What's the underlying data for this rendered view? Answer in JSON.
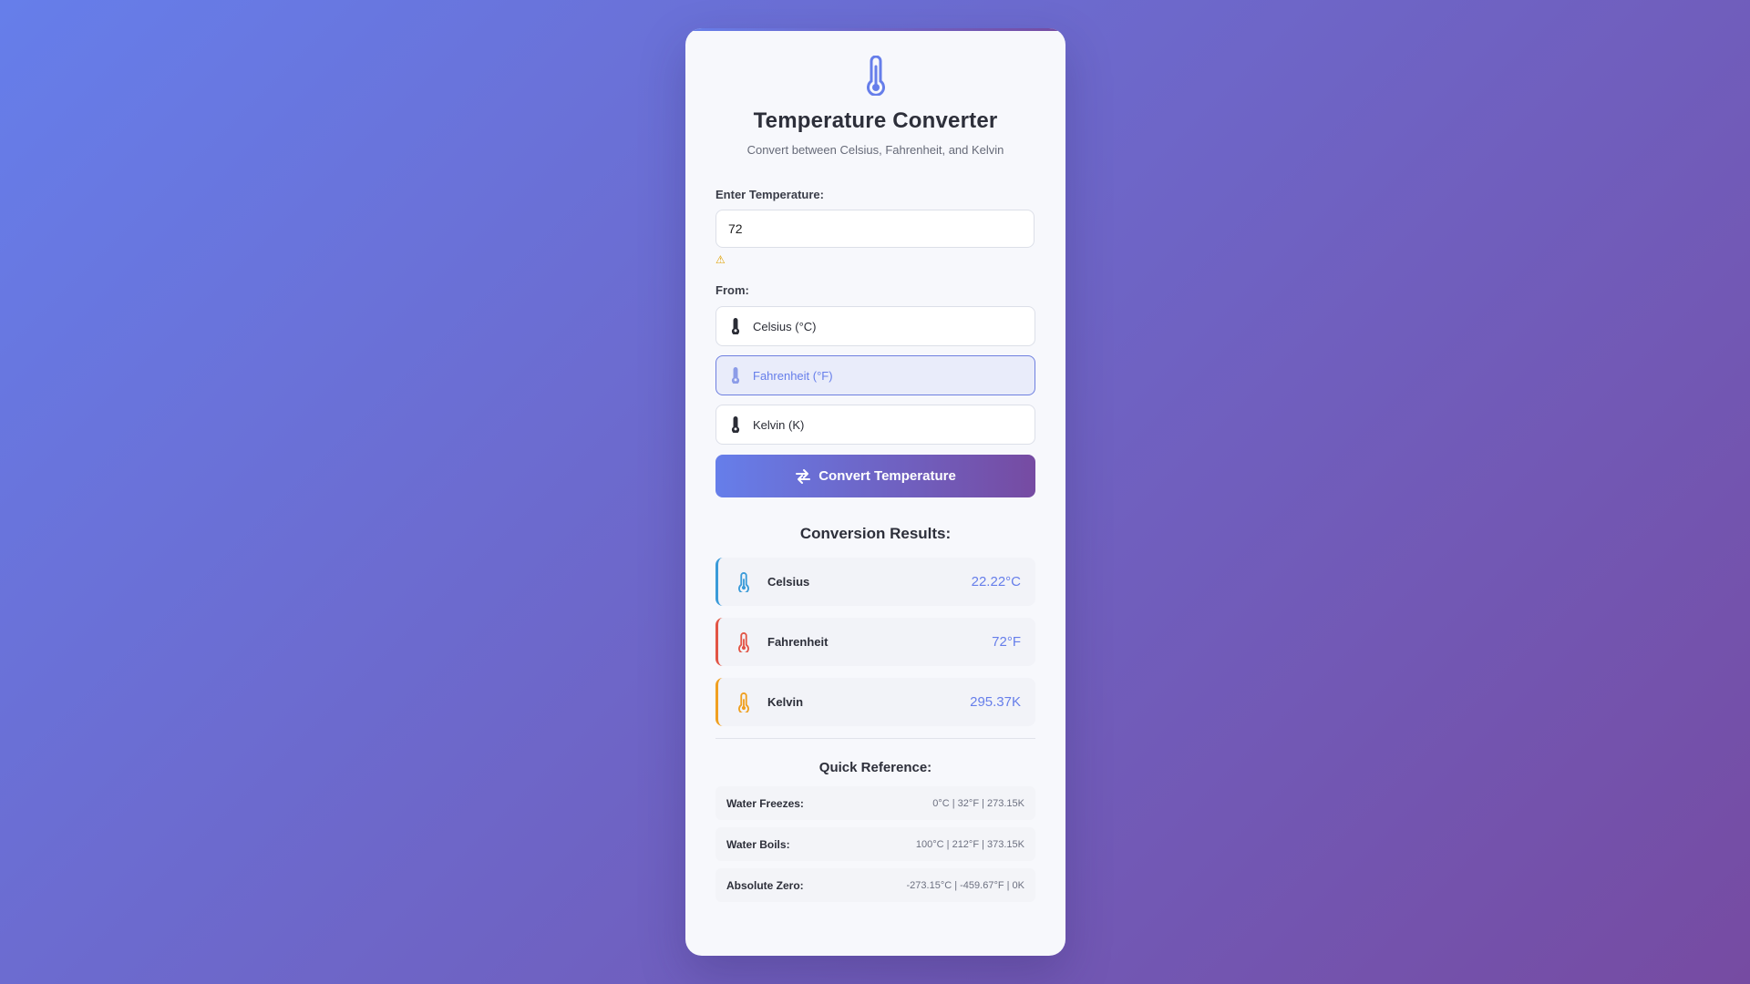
{
  "header": {
    "title": "Temperature Converter",
    "subtitle": "Convert between Celsius, Fahrenheit, and Kelvin",
    "icon": "thermometer-icon"
  },
  "input": {
    "label": "Enter Temperature:",
    "value": "72",
    "warning": "⚠"
  },
  "from": {
    "label": "From:",
    "options": [
      {
        "label": "Celsius (°C)",
        "selected": false
      },
      {
        "label": "Fahrenheit (°F)",
        "selected": true
      },
      {
        "label": "Kelvin (K)",
        "selected": false
      }
    ]
  },
  "convert_button": {
    "label": "Convert Temperature",
    "icon": "swap-arrows-icon"
  },
  "results": {
    "title": "Conversion Results:",
    "items": [
      {
        "name": "Celsius",
        "value": "22.22°C",
        "color": "#3a9bd9"
      },
      {
        "name": "Fahrenheit",
        "value": "72°F",
        "color": "#e25545"
      },
      {
        "name": "Kelvin",
        "value": "295.37K",
        "color": "#f0a020"
      }
    ]
  },
  "reference": {
    "title": "Quick Reference:",
    "items": [
      {
        "name": "Water Freezes:",
        "value": "0°C | 32°F | 273.15K"
      },
      {
        "name": "Water Boils:",
        "value": "100°C | 212°F | 373.15K"
      },
      {
        "name": "Absolute Zero:",
        "value": "-273.15°C | -459.67°F | 0K"
      }
    ]
  },
  "colors": {
    "accent": "#667eea",
    "accent_end": "#764ba2"
  }
}
